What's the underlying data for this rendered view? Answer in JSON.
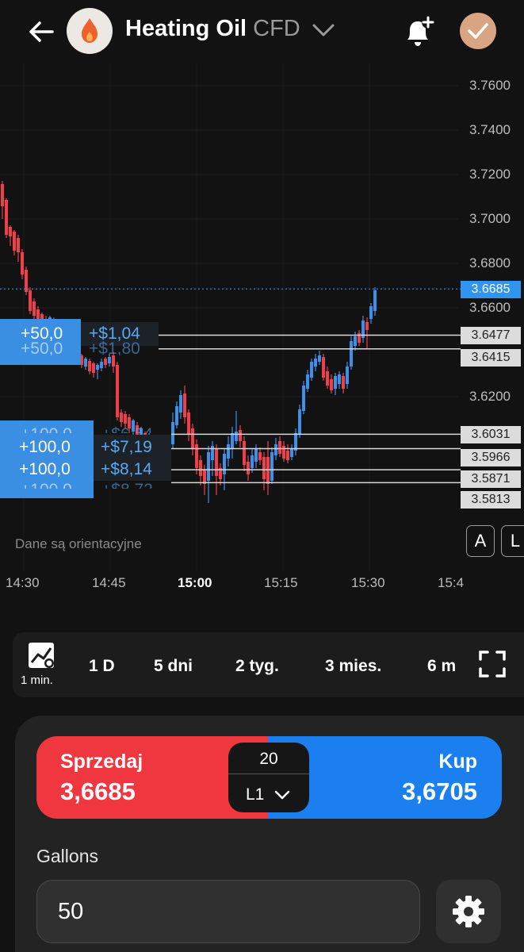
{
  "header": {
    "title": "Heating Oil",
    "subtitle": "CFD",
    "icons": {
      "back": "arrow-left-icon",
      "asset": "flame-icon",
      "chevron": "chevron-down-icon",
      "alert": "bell-plus-icon",
      "confirm": "check-icon"
    }
  },
  "chart": {
    "current_price": "3.6685",
    "y_ticks": [
      "3.7600",
      "3.7400",
      "3.7200",
      "3.7000",
      "3.6800",
      "3.6600",
      "3.6200"
    ],
    "position_lines": [
      {
        "price": "3.6477",
        "qty": "+50,0",
        "pnl": "+$1,04",
        "ghost_qty": "+50,0",
        "ghost_pnl": "+$1,80"
      },
      {
        "price": "3.6415",
        "qty": "+50,0",
        "pnl": "+$1,80"
      },
      {
        "price": "3.6031",
        "qty": "+100,0",
        "pnl": "+$6,54"
      },
      {
        "price": "3.5966",
        "qty": "+100,0",
        "pnl": "+$7,19"
      },
      {
        "price": "3.5871",
        "qty": "+100,0",
        "pnl": "+$8,14"
      },
      {
        "price": "3.5813",
        "qty": "+100,0",
        "pnl": "+$8,72"
      }
    ],
    "visible_labels": {
      "upper_qty": "+50,0",
      "upper_pnl": "+$1,04",
      "lower_qty_1": "+100,0",
      "lower_pnl_1": "+$7,19",
      "lower_qty_2": "+100,0",
      "lower_pnl_2": "+$8,14"
    },
    "disclaimer": "Dane są orientacyjne",
    "time_labels": [
      "14:30",
      "14:45",
      "15:00",
      "15:15",
      "15:30",
      "15:4"
    ],
    "buttons": {
      "a": "A",
      "l": "L"
    },
    "colors": {
      "up": "#3f8fe8",
      "down": "#ef3f4a",
      "current_line": "#2f95f0",
      "bg": "#121212"
    }
  },
  "timeframes": {
    "interval": "1 min.",
    "items": [
      "1 D",
      "5 dni",
      "2 tyg.",
      "3 mies.",
      "6 m"
    ],
    "icons": {
      "chart_type": "chart-line-icon",
      "fullscreen": "fullscreen-icon"
    }
  },
  "trade": {
    "sell_label": "Sprzedaj",
    "sell_price": "3,6685",
    "buy_label": "Kup",
    "buy_price": "3,6705",
    "spread": "20",
    "level": "L1",
    "gallons_label": "Gallons",
    "quantity": "50",
    "icons": {
      "settings": "gear-icon",
      "level_chevron": "chevron-down-icon"
    },
    "colors": {
      "sell": "#f0363f",
      "buy": "#1b7ff0"
    }
  }
}
